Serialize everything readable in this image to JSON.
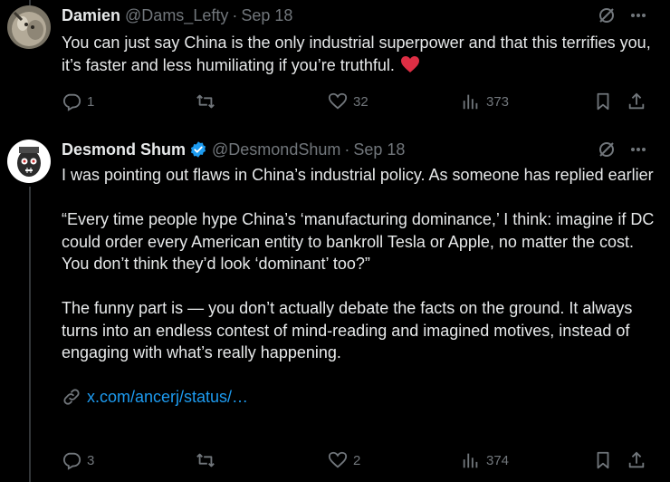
{
  "tweets": [
    {
      "name": "Damien",
      "handle": "@Dams_Lefty",
      "separator": "·",
      "date": "Sep 18",
      "text": "You can just say China is the only industrial superpower and that this terrifies you, it’s faster and less humiliating if you’re truthful.",
      "replies": "1",
      "retweets": "",
      "likes": "32",
      "views": "373"
    },
    {
      "name": "Desmond Shum",
      "handle": "@DesmondShum",
      "separator": "·",
      "date": "Sep 18",
      "paragraphs": [
        "I was pointing out flaws in China’s industrial policy. As someone has replied earlier",
        "“Every time people hype China’s ‘manufacturing dominance,’ I think: imagine if DC could order every American entity to bankroll Tesla or Apple, no matter the cost. You don’t think they’d look ‘dominant’ too?”",
        "The funny part is — you don’t actually debate the facts on the ground. It always turns into an endless contest of mind-reading and imagined motives, instead of engaging with what’s really happening."
      ],
      "link": "x.com/ancerj/status/…",
      "replies": "3",
      "retweets": "",
      "likes": "2",
      "views": "374"
    }
  ],
  "colors": {
    "background": "#000000",
    "text": "#e7e9ea",
    "muted": "#71767b",
    "link": "#1d9bf0",
    "verified": "#1d9bf0",
    "heart": "#f91880"
  }
}
